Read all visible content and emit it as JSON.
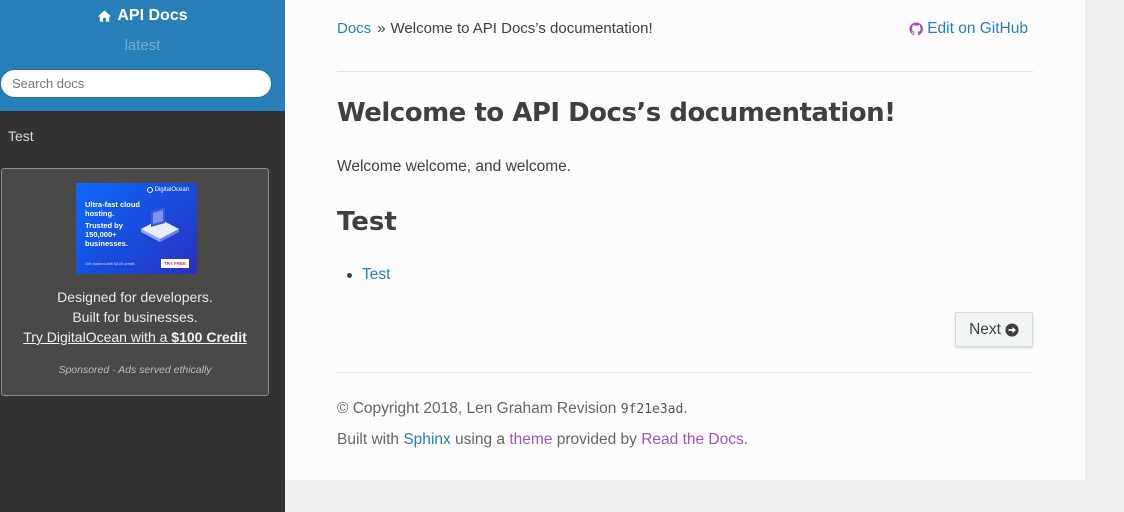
{
  "sidebar": {
    "brand": "API Docs",
    "version": "latest",
    "search_placeholder": "Search docs",
    "nav_items": [
      {
        "label": "Test"
      }
    ],
    "ad": {
      "image_logo": "DigitalOcean",
      "image_headline": "Ultra-fast cloud hosting.",
      "image_sub": "Trusted by 150,000+ businesses.",
      "image_footnote": "Get started with $100 credit.",
      "image_cta": "TRY FREE",
      "line1": "Designed for developers.",
      "line2": "Built for businesses.",
      "cta_prefix": "Try DigitalOcean with a ",
      "cta_bold": "$100 Credit",
      "sponsor": "Sponsored · Ads served ethically"
    }
  },
  "breadcrumbs": {
    "home": "Docs",
    "separator": "»",
    "current": "Welcome to API Docs’s documentation!",
    "edit_link": "Edit on GitHub"
  },
  "main": {
    "title": "Welcome to API Docs’s documentation!",
    "intro": "Welcome welcome, and welcome.",
    "section_title": "Test",
    "toc": [
      {
        "label": "Test"
      }
    ],
    "next_button": "Next"
  },
  "footer": {
    "copyright": "© Copyright 2018, Len Graham Revision ",
    "revision": "9f21e3ad",
    "revision_suffix": ".",
    "built_with": "Built with ",
    "sphinx": "Sphinx",
    "using_a": " using a ",
    "theme": "theme",
    "provided_by": " provided by ",
    "rtd": "Read the Docs",
    "end": "."
  },
  "colors": {
    "accent": "#2980b9",
    "sidebar_bg": "#343131",
    "visited_link": "#9b59b6"
  },
  "icons": [
    "home-icon",
    "github-icon",
    "arrow-circle-right-icon"
  ]
}
